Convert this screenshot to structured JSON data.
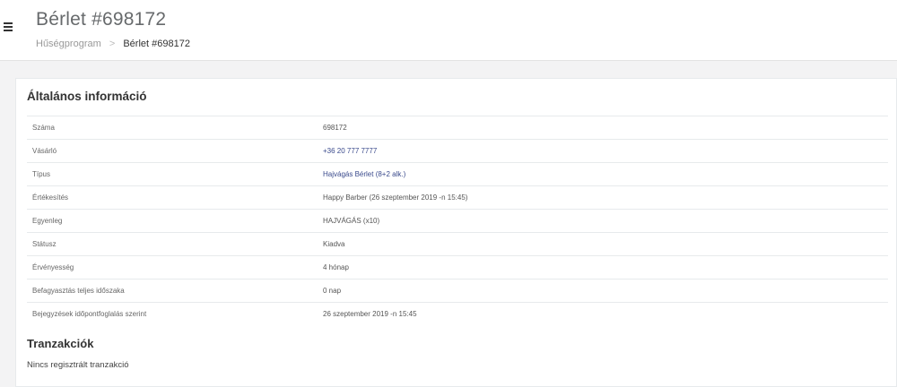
{
  "header": {
    "title": "Bérlet #698172",
    "breadcrumb": [
      {
        "label": "Hűségprogram"
      },
      {
        "label": "Bérlet #698172"
      }
    ],
    "breadcrumb_separator": ">"
  },
  "general": {
    "title": "Általános információ",
    "rows": [
      {
        "label": "Száma",
        "value": "698172",
        "link": false
      },
      {
        "label": "Vásárló",
        "value": "+36 20 777 7777",
        "link": true
      },
      {
        "label": "Típus",
        "value": "Hajvágás Bérlet (8+2 alk.)",
        "link": true
      },
      {
        "label": "Értékesítés",
        "value": "Happy Barber (26 szeptember 2019 -n 15:45)",
        "link": false
      },
      {
        "label": "Egyenleg",
        "value": "HAJVÁGÁS (x10)",
        "link": false
      },
      {
        "label": "Státusz",
        "value": "Kiadva",
        "link": false
      },
      {
        "label": "Érvényesség",
        "value": "4 hónap",
        "link": false
      },
      {
        "label": "Befagyasztás teljes időszaka",
        "value": "0 nap",
        "link": false
      },
      {
        "label": "Bejegyzések időpontfoglalás szerint",
        "value": "26 szeptember 2019 -n 15:45",
        "link": false
      }
    ]
  },
  "transactions": {
    "title": "Tranzakciók",
    "empty_text": "Nincs regisztrált tranzakció"
  },
  "colors": {
    "link": "#3a4a8c",
    "background": "#f3f3f4",
    "card": "#ffffff"
  },
  "icons": {
    "menu": "hamburger-icon"
  }
}
